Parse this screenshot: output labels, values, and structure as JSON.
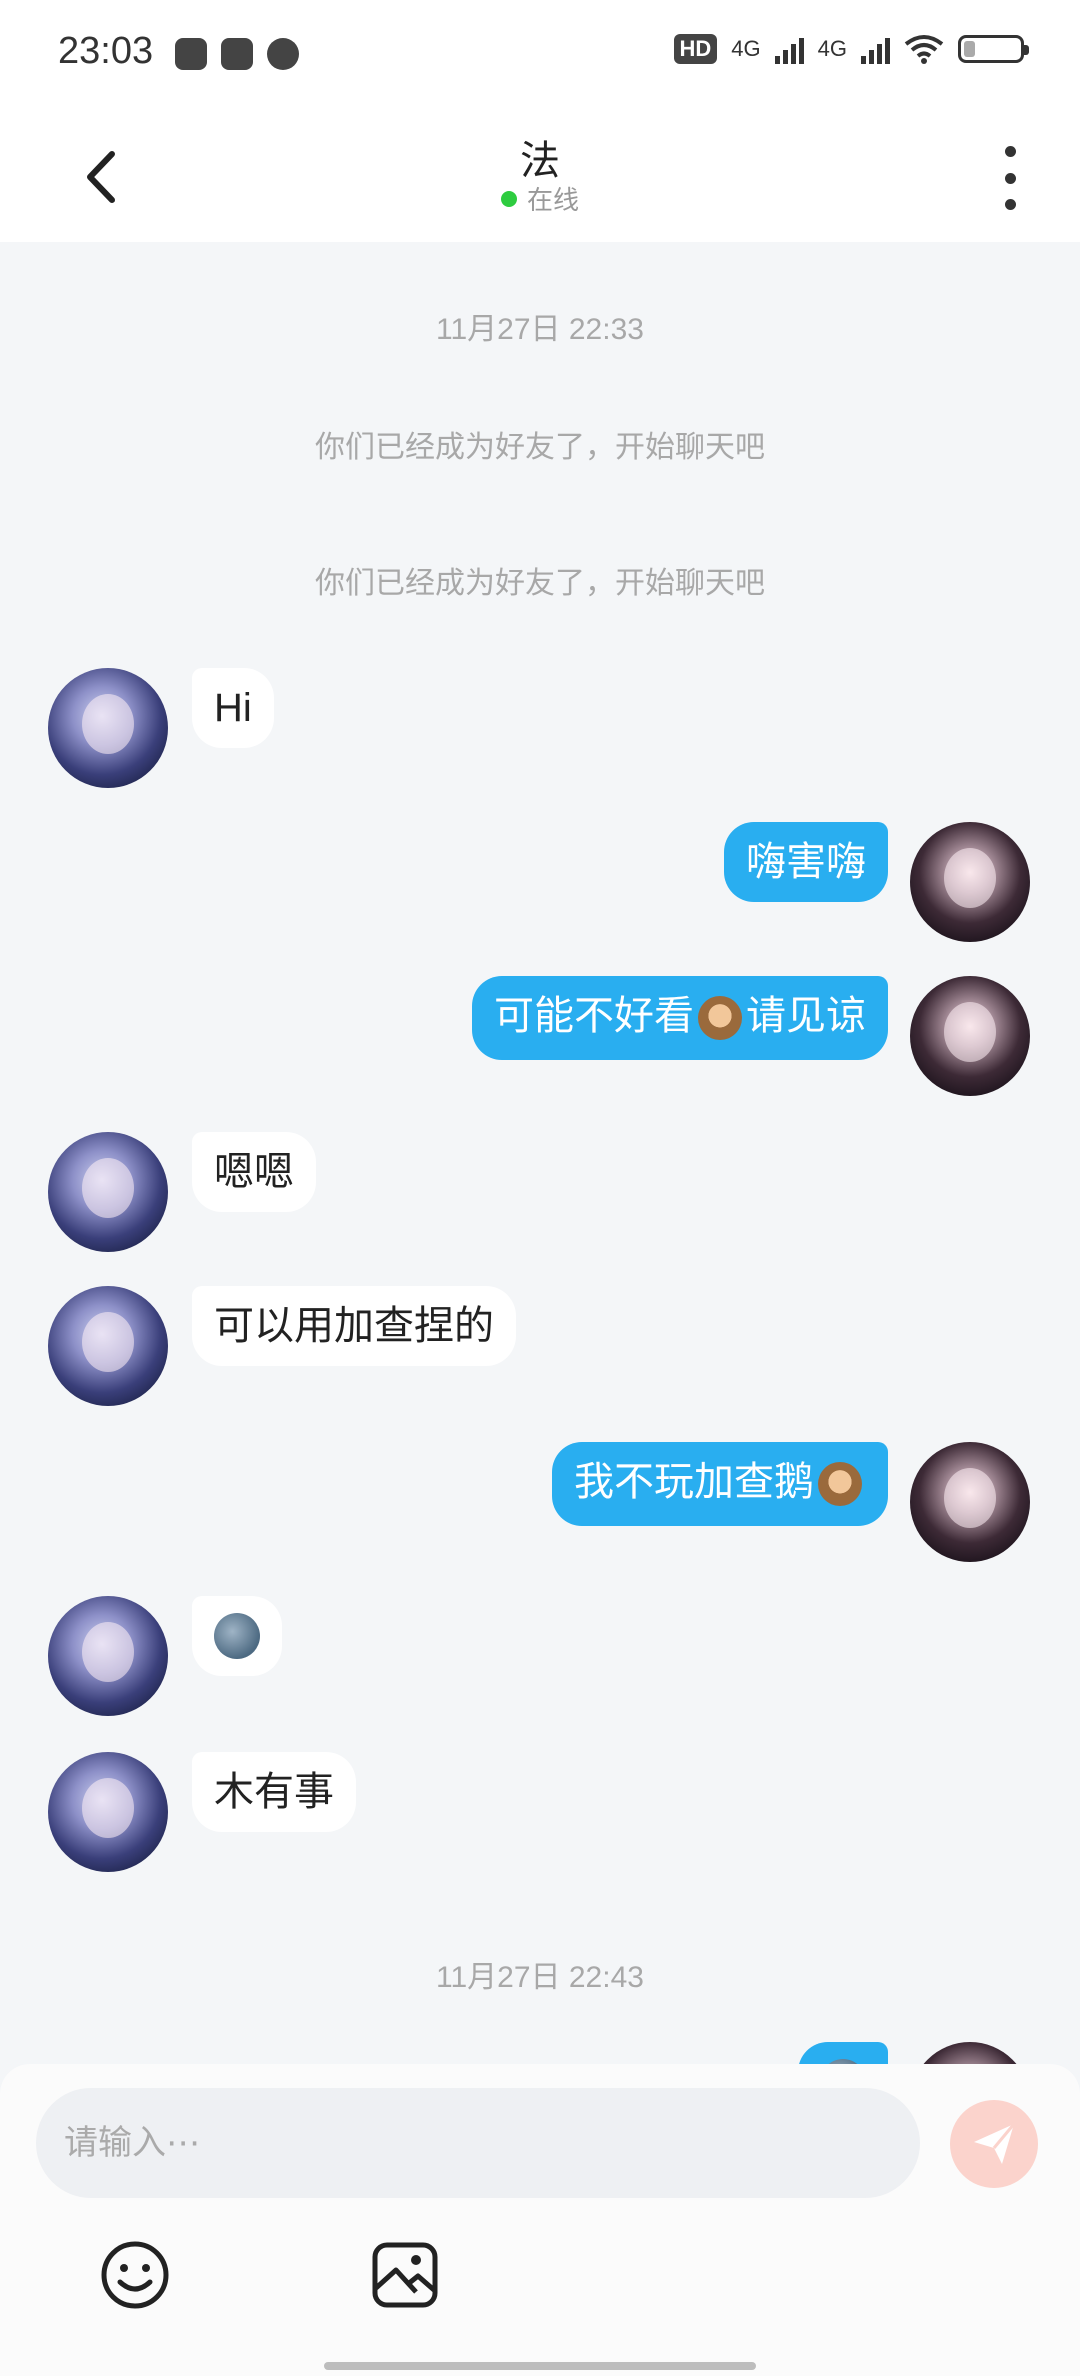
{
  "status_bar": {
    "time": "23:03",
    "network_label_1": "4G",
    "network_label_2": "4G",
    "hd_label": "HD",
    "battery_level": 0.2
  },
  "header": {
    "title": "法",
    "status": "在线",
    "status_color": "#2ecc40"
  },
  "chat": {
    "timestamps": [
      "11月27日 22:33",
      "11月27日 22:43"
    ],
    "system_messages": [
      "你们已经成为好友了，开始聊天吧",
      "你们已经成为好友了，开始聊天吧"
    ],
    "messages": [
      {
        "from": "other",
        "text": "Hi"
      },
      {
        "from": "me",
        "text": "嗨害嗨"
      },
      {
        "from": "me",
        "text_before": "可能不好看",
        "emoji": "see-no-evil-monkey",
        "text_after": "请见谅"
      },
      {
        "from": "other",
        "text": "嗯嗯"
      },
      {
        "from": "other",
        "text": "可以用加查捏的"
      },
      {
        "from": "me",
        "text_before": "我不玩加查鹅",
        "emoji": "see-no-evil-monkey"
      },
      {
        "from": "other",
        "emoji": "new-moon-face"
      },
      {
        "from": "other",
        "text": "木有事"
      },
      {
        "from": "me",
        "emoji": "new-moon-face",
        "partially_visible": true
      }
    ],
    "outgoing_bubble_color": "#29aef0",
    "incoming_bubble_color": "#ffffff"
  },
  "input": {
    "placeholder": "请输入⋯"
  },
  "icons": {
    "back": "back-arrow-icon",
    "more": "more-vertical-icon",
    "send": "send-paper-plane-icon",
    "emoji": "smiley-icon",
    "image": "image-icon"
  }
}
